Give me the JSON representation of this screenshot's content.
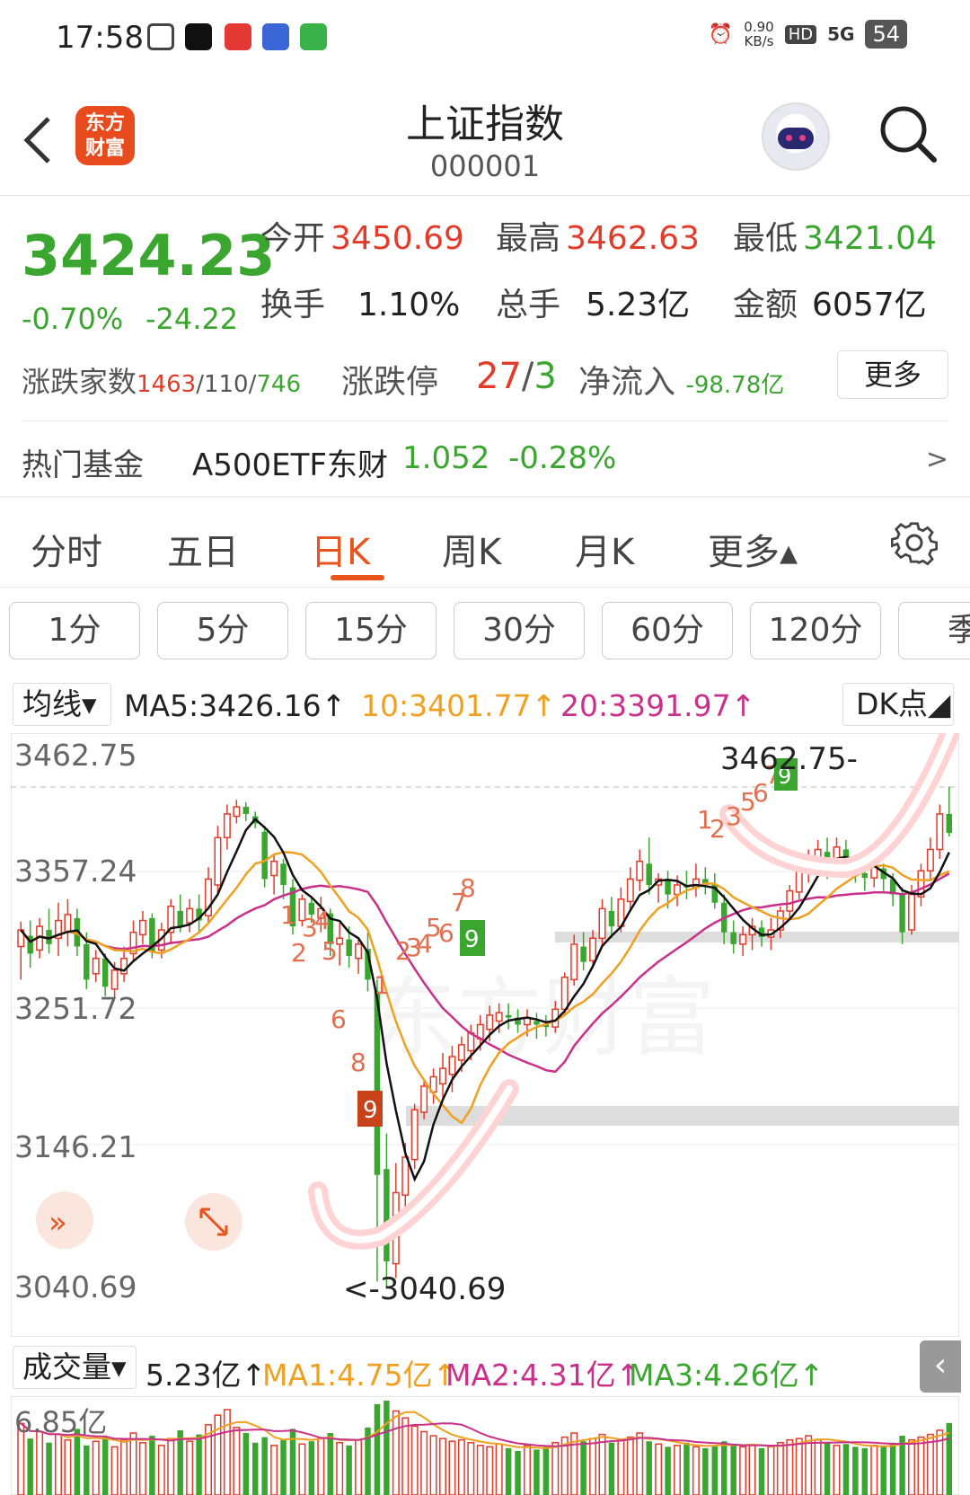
{
  "status": {
    "time": "17:58",
    "speed_value": "0.90",
    "speed_unit": "KB/s",
    "hd": "HD",
    "network": "5G",
    "battery": "54"
  },
  "header": {
    "logo_line1": "东方",
    "logo_line2": "财富",
    "title": "上证指数",
    "code": "000001"
  },
  "quote": {
    "price": "3424.23",
    "change_pct": "-0.70%",
    "change_abs": "-24.22",
    "open_label": "今开",
    "open": "3450.69",
    "high_label": "最高",
    "high": "3462.63",
    "low_label": "最低",
    "low": "3421.04",
    "turnover_label": "换手",
    "turnover": "1.10%",
    "volume_label": "总手",
    "volume": "5.23亿",
    "amount_label": "金额",
    "amount": "6057亿",
    "breadth_label": "涨跌家数",
    "breadth_up": "1463",
    "breadth_flat": "110",
    "breadth_down": "746",
    "limit_label": "涨跌停",
    "limit_up": "27",
    "limit_down": "3",
    "netflow_label": "净流入",
    "netflow": "-98.78亿",
    "more": "更多"
  },
  "fund": {
    "label": "热门基金",
    "name": "A500ETF东财",
    "price": "1.052",
    "change": "-0.28%",
    "arrow": ">"
  },
  "tabs": [
    "分时",
    "五日",
    "日K",
    "周K",
    "月K",
    "更多▴"
  ],
  "periods": [
    "1分",
    "5分",
    "15分",
    "30分",
    "60分",
    "120分",
    "季"
  ],
  "ma": {
    "select": "均线▾",
    "ma5": "MA5:3426.16↑",
    "ma10": "10:3401.77↑",
    "ma20": "20:3391.97↑",
    "dk": "DK点◢"
  },
  "chart_labels": {
    "y_top": "3462.75",
    "y_2": "3357.24",
    "y_3": "3251.72",
    "y_4": "3146.21",
    "y_bottom": "3040.69",
    "high_marker": "3462.75-",
    "low_marker": "<-3040.69",
    "watermark": "东方财富"
  },
  "volume": {
    "select": "成交量▾",
    "value": "5.23亿↑",
    "ma1": "MA1:4.75亿↑",
    "ma2": "MA2:4.31亿↑",
    "ma3": "MA3:4.26亿↑",
    "y_top": "6.85亿"
  },
  "colors": {
    "up": "#e23b2a",
    "down": "#3aa52f",
    "accent": "#e8531e",
    "ma5": "#111111",
    "ma10": "#f0a020",
    "ma20": "#c8308a"
  },
  "chart_data": {
    "type": "candlestick",
    "ylim": [
      3040.69,
      3462.75
    ],
    "candles": [
      [
        3328,
        3342,
        3300,
        3349
      ],
      [
        3337,
        3322,
        3310,
        3350
      ],
      [
        3325,
        3345,
        3318,
        3352
      ],
      [
        3342,
        3330,
        3322,
        3360
      ],
      [
        3335,
        3350,
        3320,
        3365
      ],
      [
        3340,
        3355,
        3328,
        3368
      ],
      [
        3352,
        3328,
        3320,
        3360
      ],
      [
        3330,
        3300,
        3292,
        3340
      ],
      [
        3305,
        3318,
        3298,
        3325
      ],
      [
        3318,
        3294,
        3286,
        3322
      ],
      [
        3292,
        3308,
        3285,
        3315
      ],
      [
        3305,
        3318,
        3298,
        3328
      ],
      [
        3322,
        3340,
        3315,
        3350
      ],
      [
        3338,
        3350,
        3330,
        3358
      ],
      [
        3352,
        3324,
        3318,
        3356
      ],
      [
        3325,
        3342,
        3318,
        3348
      ],
      [
        3340,
        3362,
        3330,
        3368
      ],
      [
        3358,
        3345,
        3340,
        3372
      ],
      [
        3348,
        3360,
        3340,
        3368
      ],
      [
        3360,
        3350,
        3340,
        3372
      ],
      [
        3354,
        3385,
        3348,
        3395
      ],
      [
        3380,
        3420,
        3372,
        3430
      ],
      [
        3420,
        3440,
        3410,
        3448
      ],
      [
        3438,
        3446,
        3432,
        3452
      ],
      [
        3446,
        3440,
        3434,
        3450
      ],
      [
        3438,
        3432,
        3428,
        3442
      ],
      [
        3425,
        3385,
        3378,
        3430
      ],
      [
        3388,
        3400,
        3372,
        3405
      ],
      [
        3398,
        3380,
        3368,
        3402
      ],
      [
        3378,
        3345,
        3338,
        3385
      ],
      [
        3350,
        3368,
        3345,
        3372
      ],
      [
        3365,
        3355,
        3348,
        3370
      ],
      [
        3352,
        3360,
        3340,
        3370
      ],
      [
        3356,
        3330,
        3320,
        3360
      ],
      [
        3330,
        3335,
        3312,
        3348
      ],
      [
        3334,
        3320,
        3310,
        3345
      ],
      [
        3318,
        3330,
        3305,
        3335
      ],
      [
        3326,
        3300,
        3290,
        3340
      ],
      [
        3290,
        3135,
        3045,
        3300
      ],
      [
        3140,
        3062,
        3041,
        3170
      ],
      [
        3060,
        3120,
        3048,
        3145
      ],
      [
        3118,
        3150,
        3108,
        3162
      ],
      [
        3148,
        3190,
        3140,
        3195
      ],
      [
        3188,
        3210,
        3182,
        3216
      ],
      [
        3205,
        3218,
        3195,
        3225
      ],
      [
        3212,
        3225,
        3200,
        3238
      ],
      [
        3220,
        3235,
        3205,
        3244
      ],
      [
        3232,
        3245,
        3222,
        3252
      ],
      [
        3240,
        3255,
        3232,
        3262
      ],
      [
        3250,
        3262,
        3240,
        3270
      ],
      [
        3258,
        3270,
        3248,
        3278
      ],
      [
        3265,
        3272,
        3255,
        3280
      ],
      [
        3270,
        3268,
        3258,
        3280
      ],
      [
        3268,
        3262,
        3255,
        3275
      ],
      [
        3262,
        3268,
        3252,
        3275
      ],
      [
        3265,
        3262,
        3250,
        3272
      ],
      [
        3262,
        3260,
        3252,
        3270
      ],
      [
        3260,
        3275,
        3255,
        3282
      ],
      [
        3275,
        3302,
        3270,
        3306
      ],
      [
        3300,
        3330,
        3295,
        3338
      ],
      [
        3328,
        3315,
        3308,
        3340
      ],
      [
        3316,
        3335,
        3310,
        3342
      ],
      [
        3335,
        3360,
        3328,
        3368
      ],
      [
        3358,
        3345,
        3335,
        3370
      ],
      [
        3345,
        3368,
        3340,
        3378
      ],
      [
        3366,
        3385,
        3360,
        3395
      ],
      [
        3384,
        3400,
        3375,
        3410
      ],
      [
        3398,
        3380,
        3372,
        3420
      ],
      [
        3380,
        3385,
        3365,
        3390
      ],
      [
        3385,
        3372,
        3360,
        3392
      ],
      [
        3372,
        3380,
        3362,
        3388
      ],
      [
        3380,
        3378,
        3368,
        3392
      ],
      [
        3378,
        3385,
        3370,
        3398
      ],
      [
        3385,
        3380,
        3372,
        3395
      ],
      [
        3380,
        3365,
        3360,
        3390
      ],
      [
        3365,
        3340,
        3330,
        3372
      ],
      [
        3340,
        3330,
        3322,
        3350
      ],
      [
        3330,
        3338,
        3320,
        3345
      ],
      [
        3338,
        3345,
        3325,
        3352
      ],
      [
        3344,
        3336,
        3328,
        3350
      ],
      [
        3336,
        3342,
        3325,
        3352
      ],
      [
        3342,
        3358,
        3335,
        3362
      ],
      [
        3358,
        3375,
        3350,
        3380
      ],
      [
        3374,
        3392,
        3368,
        3398
      ],
      [
        3390,
        3402,
        3382,
        3410
      ],
      [
        3400,
        3410,
        3390,
        3418
      ],
      [
        3408,
        3396,
        3385,
        3420
      ],
      [
        3396,
        3412,
        3390,
        3420
      ],
      [
        3410,
        3398,
        3388,
        3418
      ],
      [
        3398,
        3390,
        3382,
        3405
      ],
      [
        3390,
        3386,
        3375,
        3398
      ],
      [
        3386,
        3395,
        3378,
        3400
      ],
      [
        3394,
        3385,
        3375,
        3398
      ],
      [
        3385,
        3372,
        3362,
        3390
      ],
      [
        3372,
        3340,
        3330,
        3378
      ],
      [
        3342,
        3372,
        3338,
        3380
      ],
      [
        3370,
        3392,
        3362,
        3398
      ],
      [
        3392,
        3410,
        3385,
        3420
      ],
      [
        3410,
        3440,
        3402,
        3448
      ],
      [
        3440,
        3424,
        3421,
        3463
      ]
    ],
    "volume": [
      5.2,
      4.1,
      4.6,
      3.8,
      4.4,
      4.0,
      4.8,
      3.6,
      3.9,
      4.2,
      3.5,
      4.0,
      4.5,
      3.8,
      4.3,
      3.6,
      4.1,
      4.7,
      3.9,
      4.4,
      5.1,
      5.8,
      6.2,
      4.9,
      4.5,
      3.8,
      4.2,
      3.6,
      4.0,
      4.8,
      3.7,
      3.9,
      4.1,
      4.5,
      3.8,
      3.6,
      4.0,
      4.9,
      6.6,
      6.85,
      6.1,
      5.6,
      5.0,
      4.6,
      4.3,
      4.1,
      3.9,
      4.0,
      3.8,
      3.6,
      3.5,
      3.7,
      3.4,
      3.2,
      3.6,
      3.3,
      3.5,
      3.8,
      4.2,
      4.5,
      3.9,
      4.1,
      4.4,
      3.8,
      4.0,
      4.2,
      4.5,
      3.9,
      3.7,
      3.5,
      3.6,
      3.8,
      3.5,
      3.4,
      3.6,
      3.9,
      3.7,
      3.5,
      3.6,
      3.4,
      3.5,
      3.8,
      4.0,
      4.1,
      4.3,
      4.0,
      3.8,
      3.6,
      3.7,
      3.5,
      3.4,
      3.6,
      3.5,
      3.8,
      4.3,
      4.0,
      4.2,
      4.4,
      4.7,
      5.23
    ]
  }
}
